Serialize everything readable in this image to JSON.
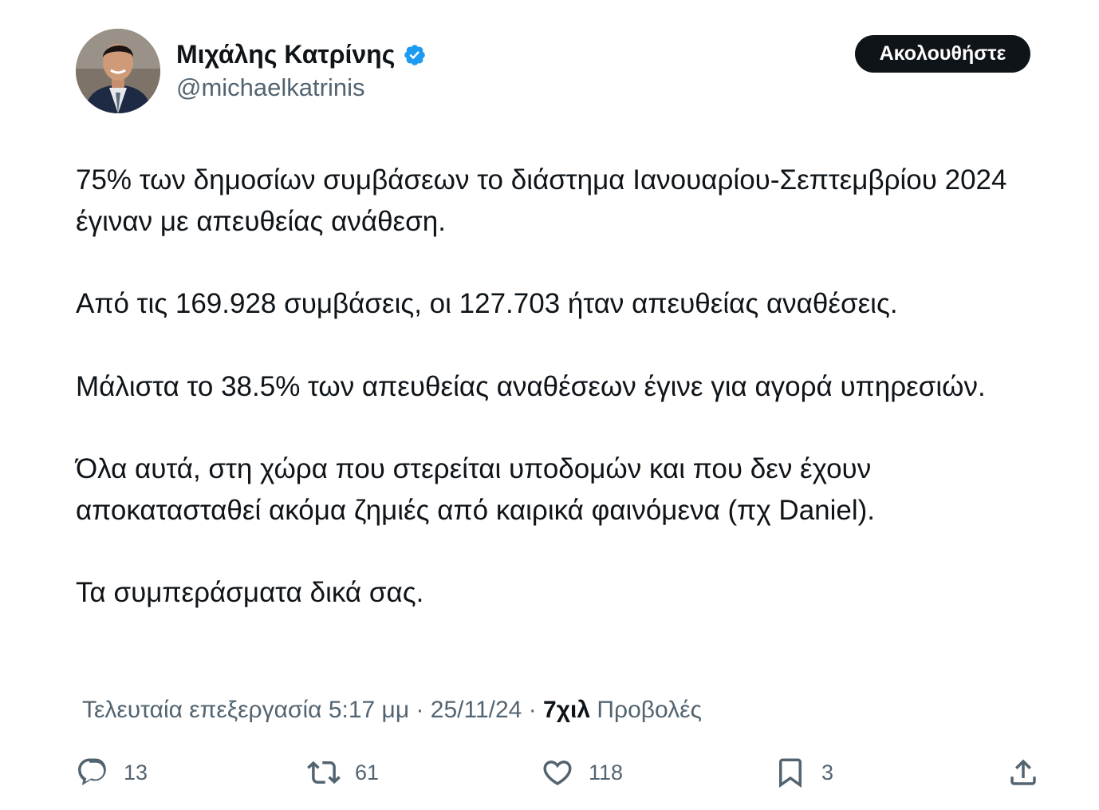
{
  "author": {
    "display_name": "Μιχάλης Κατρίνης",
    "handle": "@michaelkatrinis",
    "verified": true
  },
  "follow_button_label": "Ακολουθήστε",
  "tweet": {
    "paragraphs": [
      "75% των δημοσίων συμβάσεων το διάστημα Ιανουαρίου-Σεπτεμβρίου 2024 έγιναν με απευθείας ανάθεση.",
      "Από τις 169.928 συμβάσεις, οι 127.703 ήταν απευθείας αναθέσεις.",
      "Μάλιστα το 38.5% των απευθείας αναθέσεων έγινε για αγορά υπηρεσιών.",
      "Όλα αυτά, στη χώρα που στερείται υποδομών και που δεν έχουν αποκατασταθεί ακόμα ζημιές από καιρικά φαινόμενα (πχ Daniel).",
      "Τα συμπεράσματα δικά σας."
    ]
  },
  "meta": {
    "edited_label": "Τελευταία επεξεργασία",
    "time": "5:17 μμ",
    "separator": " · ",
    "date": "25/11/24",
    "views_separator": " · ",
    "views_count": "7χιλ",
    "views_label": "Προβολές"
  },
  "actions": {
    "replies": "13",
    "reposts": "61",
    "likes": "118",
    "bookmarks": "3"
  },
  "colors": {
    "text": "#0f1419",
    "secondary": "#536471",
    "verified": "#1d9bf0",
    "button_bg": "#0f1419"
  },
  "icons": [
    "verified-badge-icon",
    "reply-icon",
    "repost-icon",
    "like-icon",
    "bookmark-icon",
    "share-icon"
  ]
}
